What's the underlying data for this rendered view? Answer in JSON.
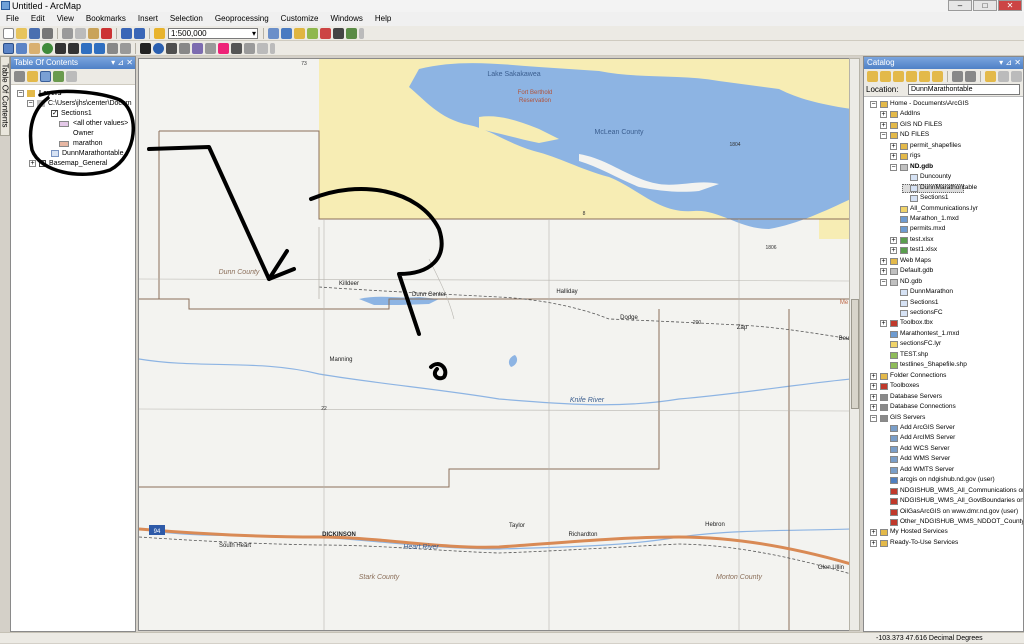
{
  "window": {
    "title": "Untitled - ArcMap"
  },
  "menu": [
    "File",
    "Edit",
    "View",
    "Bookmarks",
    "Insert",
    "Selection",
    "Geoprocessing",
    "Customize",
    "Windows",
    "Help"
  ],
  "toolbar": {
    "scale": "1:500,000"
  },
  "toc": {
    "title": "Table Of Contents",
    "side_tab": "Table Of Contents",
    "layers_label": "Layers",
    "path_label": "C:\\Users\\jhs\\center\\Docum",
    "sections_label": "Sections1",
    "other_values": "<all other values>",
    "owner_label": "Owner",
    "marathon_label": "marathon",
    "table_label": "DunnMarathontable",
    "basemap_label": "Basemap_General",
    "colors": {
      "other_values": "#e4c9e8",
      "marathon": "#e7b7a3"
    }
  },
  "map": {
    "labels": {
      "lake": "Lake Sakakawea",
      "reservation1": "Fort Berthold",
      "reservation2": "Reservation",
      "mclean": "McLean County",
      "dunn": "Dunn County",
      "stark": "Stark County",
      "morton": "Morton County",
      "killdeer": "Killdeer",
      "dunn_center": "Dunn Center",
      "halliday": "Halliday",
      "dodge": "Dodge",
      "zap": "Zap",
      "beu": "Beu",
      "manning": "Manning",
      "knife": "Knife River",
      "heart": "Heart River",
      "dickinson": "DICKINSON",
      "taylor": "Taylor",
      "richardton": "Richardton",
      "hebron": "Hebron",
      "glen": "Glen Ullin",
      "south_heart": "South Heart",
      "me": "Me",
      "hw73": "73",
      "hw1804": "1804",
      "hw8": "8",
      "hw1806": "1806",
      "hw200": "200",
      "hw22": "22",
      "hw94": "94"
    },
    "colors": {
      "water": "#8db4e3",
      "reservation": "#f7edb4",
      "road": "#d98a55",
      "county": "#8b6f5a",
      "annotation": "#000000"
    }
  },
  "catalog": {
    "title": "Catalog",
    "location_label": "Location:",
    "location_value": "DunnMarathontable",
    "tree": [
      "Home - Documents\\ArcGIS",
      "AddIns",
      "GIS ND FILES",
      "ND FILES",
      "permit_shapefiles",
      "rigs",
      "ND.gdb",
      "Duncounty",
      "DunnMarathontable",
      "Sections1",
      "All_Communications.lyr",
      "Marathon_1.mxd",
      "permits.mxd",
      "test.xlsx",
      "test1.xlsx",
      "Web Maps",
      "Default.gdb",
      "ND.gdb",
      "DunnMarathon",
      "Sections1",
      "sectionsFC",
      "Toolbox.tbx",
      "Marathontest_1.mxd",
      "sectionsFC.lyr",
      "TEST.shp",
      "testlines_Shapefile.shp",
      "Folder Connections",
      "Toolboxes",
      "Database Servers",
      "Database Connections",
      "GIS Servers",
      "Add ArcGIS Server",
      "Add ArcIMS Server",
      "Add WCS Server",
      "Add WMS Server",
      "Add WMTS Server",
      "arcgis on ndgishub.nd.gov (user)",
      "NDGISHUB_WMS_All_Communications on",
      "NDGISHUB_WMS_All_GovtBoundaries on",
      "OilGasArcGIS on www.dmr.nd.gov (user)",
      "Other_NDGISHUB_WMS_NDDOT_County",
      "My Hosted Services",
      "Ready-To-Use Services"
    ]
  },
  "status": {
    "coords": "-103.373  47.616 Decimal Degrees"
  }
}
